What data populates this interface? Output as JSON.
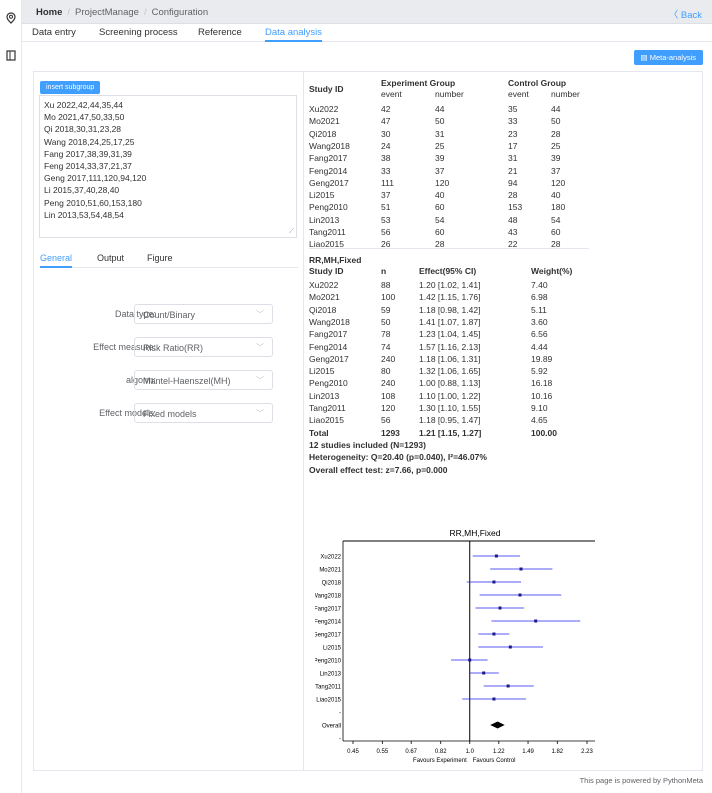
{
  "rail": {
    "icons": [
      "location-pin-icon",
      "panel-icon"
    ]
  },
  "breadcrumb": {
    "home": "Home",
    "project": "ProjectManage",
    "page": "Configuration"
  },
  "back_label": "〈 Back",
  "tabs": [
    "Data entry",
    "Screening process",
    "Reference",
    "Data analysis"
  ],
  "active_tab": "Data analysis",
  "meta_button": "Meta-analysis",
  "subgroup_button": "insert subgroup",
  "data_lines": [
    "Xu 2022,42,44,35,44",
    "Mo 2021,47,50,33,50",
    "Qi 2018,30,31,23,28",
    "Wang 2018,24,25,17,25",
    "Fang 2017,38,39,31,39",
    "Feng 2014,33,37,21,37",
    "Geng 2017,111,120,94,120",
    "Li 2015,37,40,28,40",
    "Peng 2010,51,60,153,180",
    "Lin 2013,53,54,48,54"
  ],
  "left_tabs": [
    "General",
    "Output",
    "Figure"
  ],
  "form": [
    {
      "label": "Data type:",
      "value": "Count/Binary"
    },
    {
      "label": "Effect measure:",
      "value": "Risk Ratio(RR)"
    },
    {
      "label": "algorm:",
      "value": "Mantel-Haenszel(MH)"
    },
    {
      "label": "Effect models:",
      "value": "Fixed models"
    }
  ],
  "data_table": {
    "col_study": "Study ID",
    "exp_group": "Experiment Group",
    "ctrl_group": "Control Group",
    "sub_event": "event",
    "sub_number": "number",
    "rows": [
      [
        "Xu2022",
        "42",
        "44",
        "35",
        "44"
      ],
      [
        "Mo2021",
        "47",
        "50",
        "33",
        "50"
      ],
      [
        "Qi2018",
        "30",
        "31",
        "23",
        "28"
      ],
      [
        "Wang2018",
        "24",
        "25",
        "17",
        "25"
      ],
      [
        "Fang2017",
        "38",
        "39",
        "31",
        "39"
      ],
      [
        "Feng2014",
        "33",
        "37",
        "21",
        "37"
      ],
      [
        "Geng2017",
        "111",
        "120",
        "94",
        "120"
      ],
      [
        "Li2015",
        "37",
        "40",
        "28",
        "40"
      ],
      [
        "Peng2010",
        "51",
        "60",
        "153",
        "180"
      ],
      [
        "Lin2013",
        "53",
        "54",
        "48",
        "54"
      ],
      [
        "Tang2011",
        "56",
        "60",
        "43",
        "60"
      ],
      [
        "Liao2015",
        "26",
        "28",
        "22",
        "28"
      ]
    ]
  },
  "results": {
    "title": "RR,MH,Fixed",
    "headers": [
      "Study ID",
      "n",
      "Effect(95% CI)",
      "Weight(%)"
    ],
    "rows": [
      [
        "Xu2022",
        "88",
        "1.20 [1.02, 1.41]",
        "7.40"
      ],
      [
        "Mo2021",
        "100",
        "1.42 [1.15, 1.76]",
        "6.98"
      ],
      [
        "Qi2018",
        "59",
        "1.18 [0.98, 1.42]",
        "5.11"
      ],
      [
        "Wang2018",
        "50",
        "1.41 [1.07, 1.87]",
        "3.60"
      ],
      [
        "Fang2017",
        "78",
        "1.23 [1.04, 1.45]",
        "6.56"
      ],
      [
        "Feng2014",
        "74",
        "1.57 [1.16, 2.13]",
        "4.44"
      ],
      [
        "Geng2017",
        "240",
        "1.18 [1.06, 1.31]",
        "19.89"
      ],
      [
        "Li2015",
        "80",
        "1.32 [1.06, 1.65]",
        "5.92"
      ],
      [
        "Peng2010",
        "240",
        "1.00 [0.88, 1.13]",
        "16.18"
      ],
      [
        "Lin2013",
        "108",
        "1.10 [1.00, 1.22]",
        "10.16"
      ],
      [
        "Tang2011",
        "120",
        "1.30 [1.10, 1.55]",
        "9.10"
      ],
      [
        "Liao2015",
        "56",
        "1.18 [0.95, 1.47]",
        "4.65"
      ]
    ],
    "total": [
      "Total",
      "1293",
      "1.21 [1.15, 1.27]",
      "100.00"
    ],
    "summary1": "12 studies included (N=1293)",
    "summary2": "Heterogeneity: Q=20.40 (p=0.040), I²=46.07%",
    "summary3": "Overall effect test: z=7.66, p=0.000"
  },
  "chart_data": {
    "type": "scatter",
    "title": "RR,MH,Fixed",
    "xscale": "log",
    "xticks": [
      "0.45",
      "0.55",
      "0.67",
      "0.82",
      "1.0",
      "1.22",
      "1.49",
      "1.82",
      "2.23"
    ],
    "xlabel_left": "Favours Experiment",
    "xlabel_right": "Favours Control",
    "reference_line": 1.0,
    "studies": [
      {
        "label": "Xu2022",
        "est": 1.2,
        "lo": 1.02,
        "hi": 1.41
      },
      {
        "label": "Mo2021",
        "est": 1.42,
        "lo": 1.15,
        "hi": 1.76
      },
      {
        "label": "Qi2018",
        "est": 1.18,
        "lo": 0.98,
        "hi": 1.42
      },
      {
        "label": "Wang2018",
        "est": 1.41,
        "lo": 1.07,
        "hi": 1.87
      },
      {
        "label": "Fang2017",
        "est": 1.23,
        "lo": 1.04,
        "hi": 1.45
      },
      {
        "label": "Feng2014",
        "est": 1.57,
        "lo": 1.16,
        "hi": 2.13
      },
      {
        "label": "Geng2017",
        "est": 1.18,
        "lo": 1.06,
        "hi": 1.31
      },
      {
        "label": "Li2015",
        "est": 1.32,
        "lo": 1.06,
        "hi": 1.65
      },
      {
        "label": "Peng2010",
        "est": 1.0,
        "lo": 0.88,
        "hi": 1.13
      },
      {
        "label": "Lin2013",
        "est": 1.1,
        "lo": 1.0,
        "hi": 1.22
      },
      {
        "label": "Tang2011",
        "est": 1.3,
        "lo": 1.1,
        "hi": 1.55
      },
      {
        "label": "Liao2015",
        "est": 1.18,
        "lo": 0.95,
        "hi": 1.47
      }
    ],
    "overall_label": "Overall",
    "overall": {
      "est": 1.21,
      "lo": 1.15,
      "hi": 1.27
    },
    "colors": {
      "ci": "#2222ee",
      "point": "#1a1a8c",
      "overall": "#000000"
    }
  },
  "footer": "This page is powered by PythonMeta"
}
